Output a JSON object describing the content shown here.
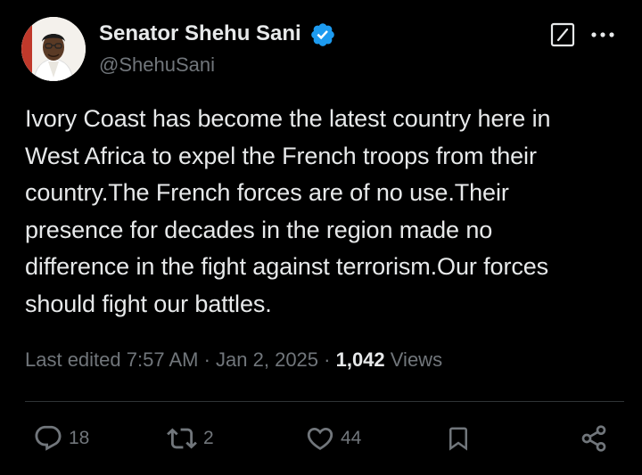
{
  "author": {
    "display_name": "Senator Shehu Sani",
    "handle": "@ShehuSani",
    "verified": true,
    "verified_color": "#1d9bf0"
  },
  "tweet": {
    "text": "Ivory Coast has become the latest country here in\nWest Africa to expel the French troops from their\ncountry.The French forces are of no use.Their\npresence for decades in the region made no\ndifference in the fight against terrorism.Our forces\nshould fight our battles."
  },
  "meta": {
    "edited_label": "Last edited",
    "time": "7:57 AM",
    "separator": " · ",
    "date": "Jan 2, 2025",
    "views_count": "1,042",
    "views_label": "Views"
  },
  "actions": {
    "replies": "18",
    "reposts": "2",
    "likes": "44"
  },
  "icons": {
    "edit": "edit-icon",
    "more": "more-icon",
    "reply": "reply-icon",
    "repost": "repost-icon",
    "like": "heart-icon",
    "bookmark": "bookmark-icon",
    "share": "share-icon"
  },
  "colors": {
    "background": "#000000",
    "text": "#e7e9ea",
    "secondary": "#71767b"
  }
}
